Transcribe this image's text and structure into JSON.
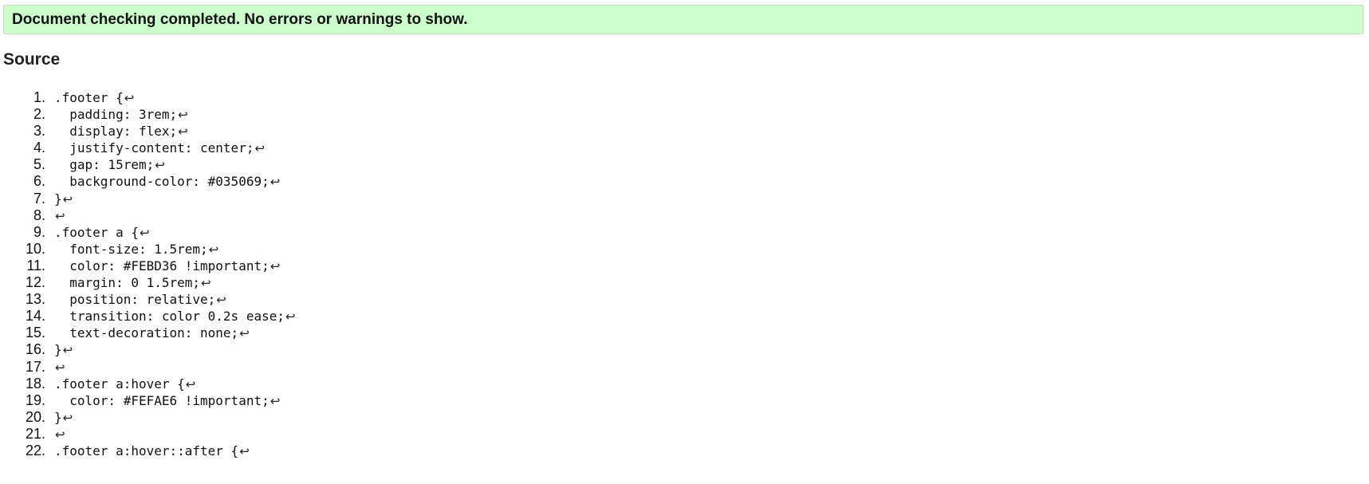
{
  "banner": {
    "message": "Document checking completed. No errors or warnings to show."
  },
  "source": {
    "heading": "Source",
    "newline_marker": "↩",
    "lines": [
      ".footer {",
      "  padding: 3rem;",
      "  display: flex;",
      "  justify-content: center;",
      "  gap: 15rem;",
      "  background-color: #035069;",
      "}",
      "",
      ".footer a {",
      "  font-size: 1.5rem;",
      "  color: #FEBD36 !important;",
      "  margin: 0 1.5rem;",
      "  position: relative;",
      "  transition: color 0.2s ease;",
      "  text-decoration: none;",
      "}",
      "",
      ".footer a:hover {",
      "  color: #FEFAE6 !important;",
      "}",
      "",
      ".footer a:hover::after {"
    ]
  },
  "colors": {
    "banner_background": "#ccffcc",
    "page_background": "#ffffff"
  }
}
